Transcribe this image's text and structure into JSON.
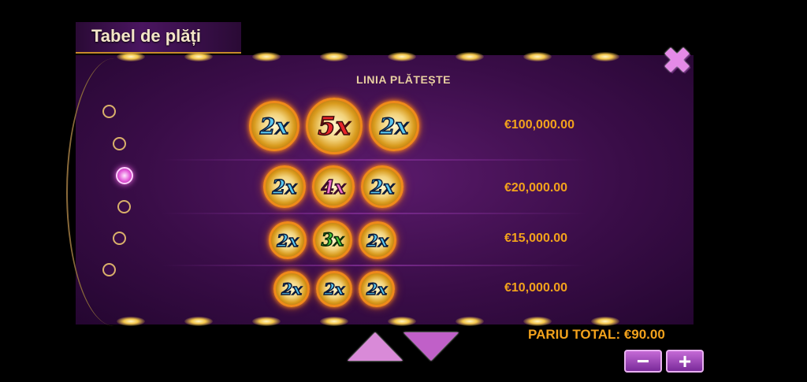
{
  "title": "Tabel de plăți",
  "header": "LINIA PLĂTEȘTE",
  "close_icon": "close-icon",
  "rows": [
    {
      "symbols": [
        {
          "text": "2x",
          "color": "blue"
        },
        {
          "text": "5x",
          "color": "red"
        },
        {
          "text": "2x",
          "color": "blue"
        }
      ],
      "payout": "€100,000.00"
    },
    {
      "symbols": [
        {
          "text": "2x",
          "color": "blue"
        },
        {
          "text": "4x",
          "color": "pink"
        },
        {
          "text": "2x",
          "color": "blue"
        }
      ],
      "payout": "€20,000.00"
    },
    {
      "symbols": [
        {
          "text": "2x",
          "color": "blue"
        },
        {
          "text": "3x",
          "color": "green"
        },
        {
          "text": "2x",
          "color": "blue"
        }
      ],
      "payout": "€15,000.00"
    },
    {
      "symbols": [
        {
          "text": "2x",
          "color": "blue"
        },
        {
          "text": "2x",
          "color": "blue"
        },
        {
          "text": "2x",
          "color": "blue"
        }
      ],
      "payout": "€10,000.00"
    }
  ],
  "pages": {
    "count": 6,
    "active": 3
  },
  "bet_total": "PARIU TOTAL: €90.00",
  "minus_label": "−",
  "plus_label": "+",
  "colors": {
    "accent": "#f2a21c",
    "panel": "#3a0d48",
    "button": "#c060c8"
  }
}
